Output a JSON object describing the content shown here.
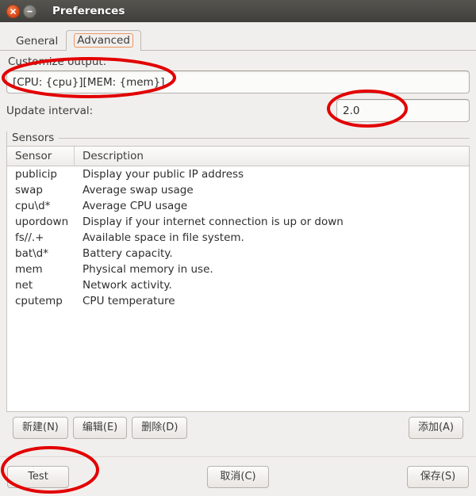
{
  "window": {
    "title": "Preferences",
    "close_icon": "close-icon",
    "minimize_icon": "minimize-icon"
  },
  "tabs": [
    {
      "label": "General",
      "active": false
    },
    {
      "label": "Advanced",
      "active": true
    }
  ],
  "form": {
    "output_label": "Customize output:",
    "output_value": "[CPU: {cpu}][MEM: {mem}]",
    "interval_label": "Update interval:",
    "interval_value": "2.0"
  },
  "sensors_group": {
    "title": "Sensors",
    "columns": [
      "Sensor",
      "Description"
    ],
    "rows": [
      {
        "sensor": "publicip",
        "description": "Display your public IP address"
      },
      {
        "sensor": "swap",
        "description": "Average swap usage"
      },
      {
        "sensor": "cpu\\d*",
        "description": "Average CPU usage"
      },
      {
        "sensor": "upordown",
        "description": "Display if your internet connection is up or down"
      },
      {
        "sensor": "fs//.+",
        "description": "Available space in file system."
      },
      {
        "sensor": "bat\\d*",
        "description": "Battery capacity."
      },
      {
        "sensor": "mem",
        "description": "Physical memory in use."
      },
      {
        "sensor": "net",
        "description": "Network activity."
      },
      {
        "sensor": "cputemp",
        "description": "CPU temperature"
      }
    ]
  },
  "list_buttons": {
    "new": "新建(N)",
    "edit": "编辑(E)",
    "delete": "删除(D)",
    "add": "添加(A)"
  },
  "action_buttons": {
    "test": "Test",
    "cancel": "取消(C)",
    "save": "保存(S)"
  },
  "annotations": {
    "color": "#e20000",
    "marks": [
      {
        "name": "output-field-highlight"
      },
      {
        "name": "interval-field-highlight"
      },
      {
        "name": "test-button-highlight"
      }
    ]
  }
}
